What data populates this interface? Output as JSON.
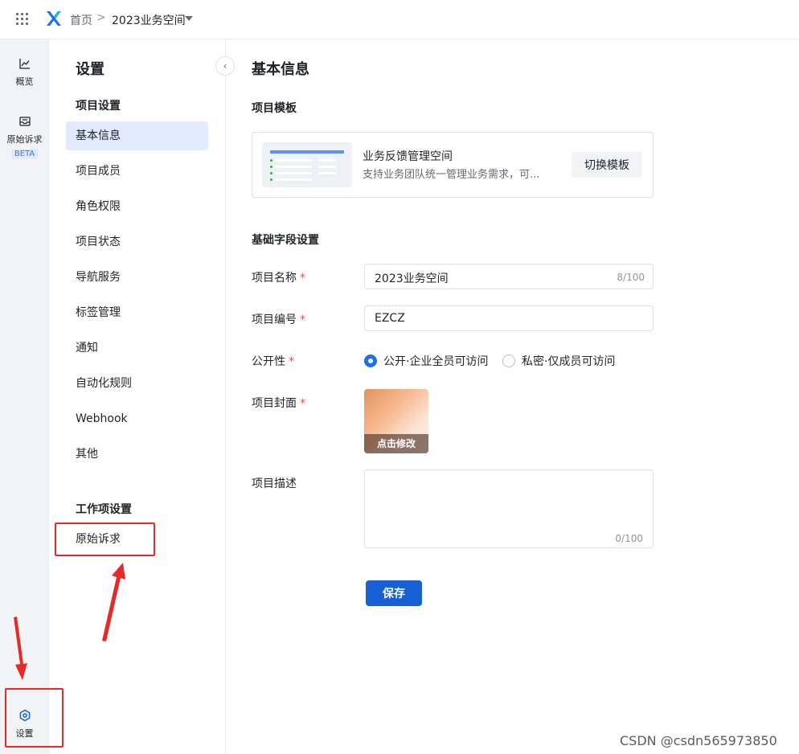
{
  "topbar": {
    "apps_icon": "grid-icon",
    "logo_icon": "x-logo-icon",
    "breadcrumb_home": "首页",
    "breadcrumb_sep": ">",
    "breadcrumb_space": "2023业务空间"
  },
  "rail": {
    "overview": {
      "label": "概览",
      "icon": "chart-line-icon"
    },
    "raw_requests": {
      "label": "原始诉求",
      "icon": "inbox-icon",
      "badge": "BETA"
    },
    "settings": {
      "label": "设置",
      "icon": "hexagon-settings-icon"
    }
  },
  "sidebar": {
    "title": "设置",
    "collapse_icon": "chevron-left-icon",
    "collapse_glyph": "‹",
    "project_group": "项目设置",
    "items": [
      {
        "label": "基本信息",
        "active": true
      },
      {
        "label": "项目成员"
      },
      {
        "label": "角色权限"
      },
      {
        "label": "项目状态"
      },
      {
        "label": "导航服务"
      },
      {
        "label": "标签管理"
      },
      {
        "label": "通知"
      },
      {
        "label": "自动化规则"
      },
      {
        "label": "Webhook"
      },
      {
        "label": "其他"
      }
    ],
    "workitem_group": "工作项设置",
    "workitem_items": [
      {
        "label": "原始诉求"
      }
    ]
  },
  "main": {
    "title": "基本信息",
    "template_section": "项目模板",
    "template": {
      "name": "业务反馈管理空间",
      "description": "支持业务团队统一管理业务需求，可...",
      "switch_label": "切换模板"
    },
    "fields_section": "基础字段设置",
    "name_field": {
      "label": "项目名称",
      "required": "*",
      "value": "2023业务空间",
      "count": "8/100"
    },
    "code_field": {
      "label": "项目编号",
      "required": "*",
      "value": "EZCZ"
    },
    "visibility_field": {
      "label": "公开性",
      "required": "*",
      "options": [
        {
          "label": "公开·企业全员可访问",
          "selected": true
        },
        {
          "label": "私密·仅成员可访问",
          "selected": false
        }
      ]
    },
    "cover_field": {
      "label": "项目封面",
      "required": "*",
      "edit_label": "点击修改"
    },
    "desc_field": {
      "label": "项目描述",
      "count": "0/100"
    },
    "save_label": "保存"
  },
  "watermark": "CSDN @csdn565973850",
  "colors": {
    "accent": "#1660d3",
    "active_bg": "#e1eaff",
    "required": "#f54a45",
    "annotation": "#e52a2a"
  }
}
